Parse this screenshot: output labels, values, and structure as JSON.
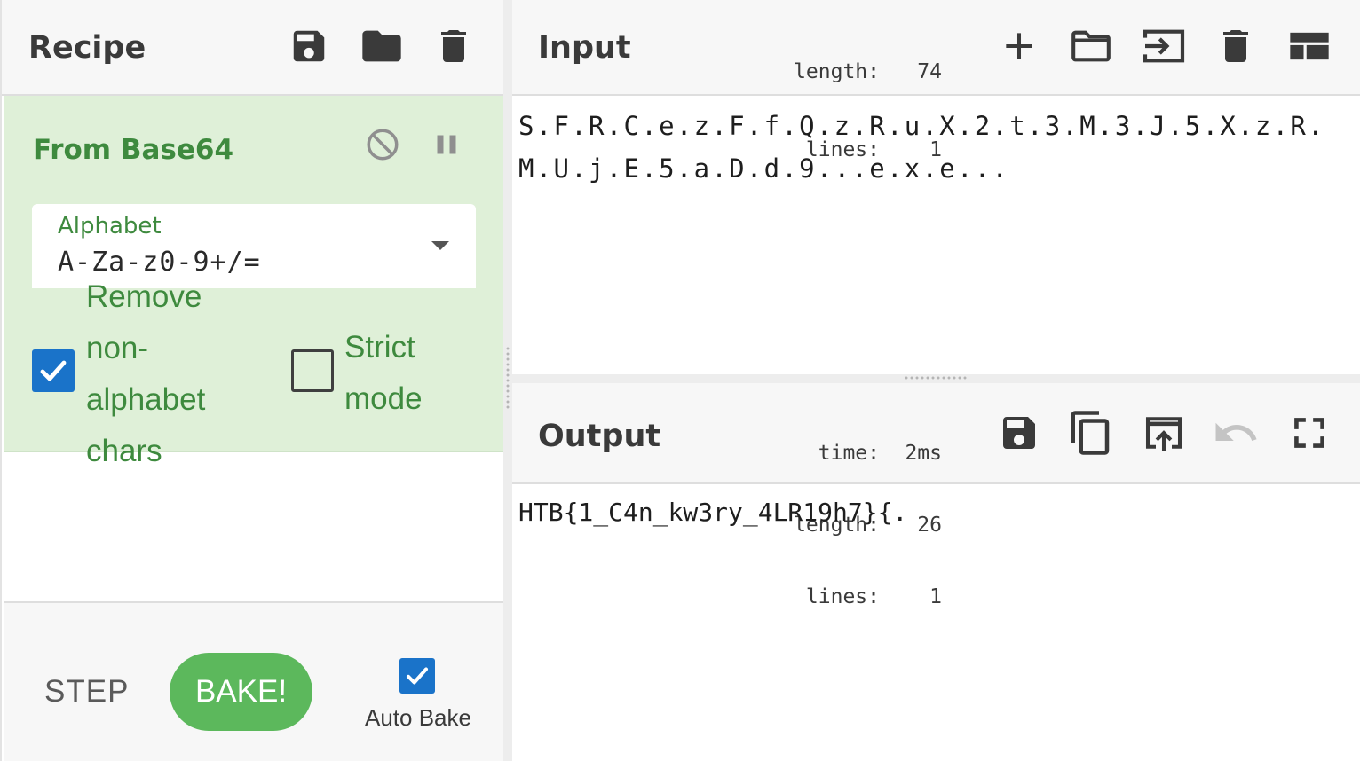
{
  "recipe": {
    "title": "Recipe",
    "buttons": {
      "save": "save-icon",
      "load": "folder-icon",
      "clear": "trash-icon"
    },
    "operation": {
      "name": "From Base64",
      "disable_icon": "disable-icon",
      "breakpoint_icon": "pause-icon",
      "alphabet": {
        "label": "Alphabet",
        "value": "A-Za-z0-9+/="
      },
      "remove_non_alphabet": {
        "checked": true,
        "label_lines": [
          "Remove",
          "non-",
          "alphabet",
          "chars"
        ]
      },
      "strict_mode": {
        "checked": false,
        "label_lines": [
          "Strict",
          "mode"
        ]
      }
    }
  },
  "controls": {
    "step_label": "STEP",
    "bake_label": "BAKE!",
    "auto_bake": {
      "label": "Auto Bake",
      "checked": true
    }
  },
  "input": {
    "title": "Input",
    "stats": {
      "length_key": "length:",
      "length_val": "74",
      "lines_key": "lines:",
      "lines_val": "1"
    },
    "text": "S.F.R.C.e.z.F.f.Q.z.R.u.X.2.t.3.M.3.J.5.X.z.R.M.U.j.E.5.a.D.d.9...e.x.e...",
    "buttons": [
      "plus-icon",
      "open-folder-icon",
      "open-file-icon",
      "trash-icon",
      "layout-icon"
    ]
  },
  "output": {
    "title": "Output",
    "stats": {
      "time_key": "time:",
      "time_val": "2ms",
      "length_key": "length:",
      "length_val": "26",
      "lines_key": "lines:",
      "lines_val": "1"
    },
    "text": "HTB{1_C4n_kw3ry_4LR19h7}{.",
    "buttons": [
      "save-icon",
      "copy-icon",
      "replace-input-icon",
      "undo-icon",
      "maximize-icon"
    ]
  },
  "colors": {
    "accent_green": "#3e8a3e",
    "operation_bg": "#dff0d8",
    "bake_button": "#5cb85c",
    "checkbox_blue": "#1a73c9"
  }
}
